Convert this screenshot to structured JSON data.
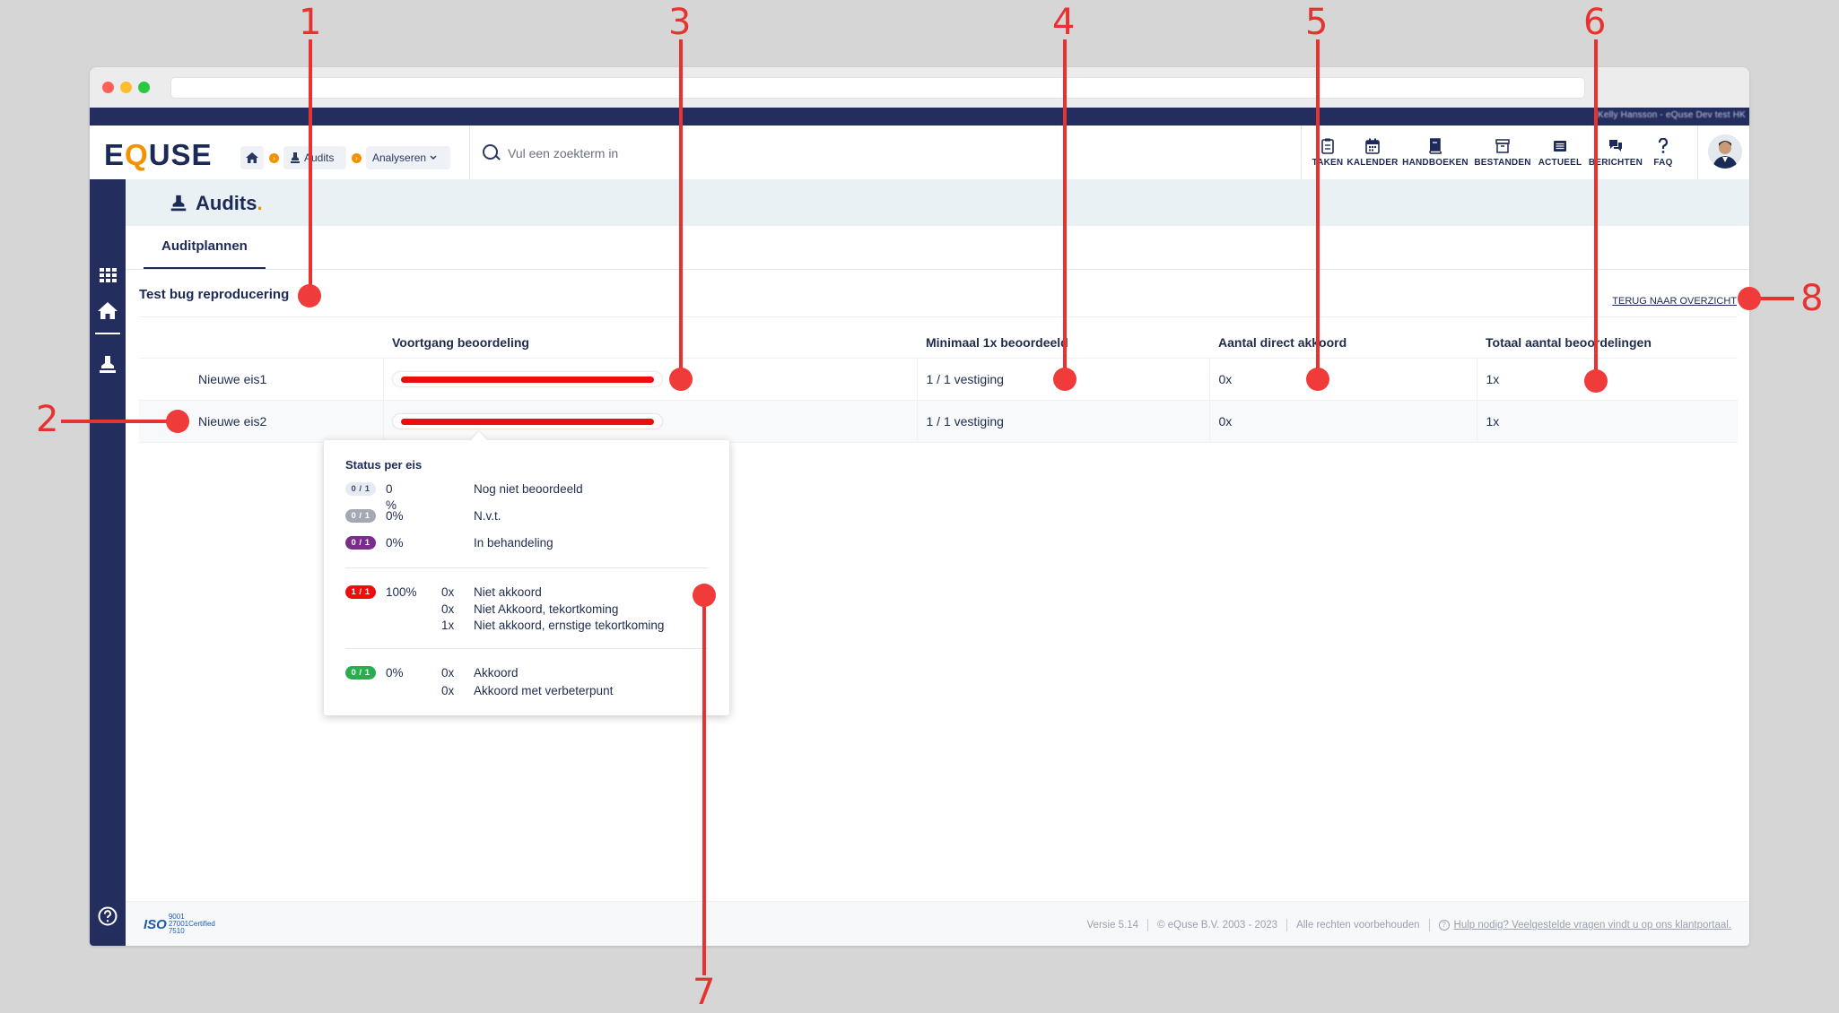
{
  "app": {
    "logo": {
      "pre": "E",
      "q": "Q",
      "post": "USE"
    },
    "user_info": "Kelly Hansson - eQuse Dev test HK",
    "breadcrumb": {
      "item1": "Audits",
      "dropdown": "Analyseren"
    },
    "search": {
      "placeholder": "Vul een zoekterm in"
    },
    "nav": [
      "TAKEN",
      "KALENDER",
      "HANDBOEKEN",
      "BESTANDEN",
      "ACTUEEL",
      "BERICHTEN",
      "FAQ"
    ]
  },
  "page": {
    "title": "Audits",
    "title_dot": ".",
    "tab": "Auditplannen",
    "section_title": "Test bug reproducering",
    "back_link": "TERUG NAAR OVERZICHT"
  },
  "table": {
    "headers": [
      "",
      "Voortgang beoordeling",
      "Minimaal 1x beoordeeld",
      "Aantal direct akkoord",
      "Totaal aantal beoordelingen"
    ],
    "rows": [
      {
        "name": "Nieuwe eis1",
        "progress": 1.0,
        "minimaal": "1 / 1 vestiging",
        "direct": "0x",
        "totaal": "1x"
      },
      {
        "name": "Nieuwe eis2",
        "progress": 1.0,
        "minimaal": "1 / 1 vestiging",
        "direct": "0x",
        "totaal": "1x"
      }
    ]
  },
  "popover": {
    "title": "Status per eis",
    "rows": [
      {
        "badge": "0 / 1",
        "badge_color": "#e5ebf1",
        "badge_text_color": "#3b4a6b",
        "pct": "0 %",
        "count": "",
        "label": "Nog niet beoordeeld"
      },
      {
        "badge": "0 / 1",
        "badge_color": "#a3a8b3",
        "badge_text_color": "#ffffff",
        "pct": "0%",
        "count": "",
        "label": "N.v.t."
      },
      {
        "badge": "0 / 1",
        "badge_color": "#7b2d8e",
        "badge_text_color": "#ffffff",
        "pct": "0%",
        "count": "",
        "label": "In behandeling"
      },
      {
        "badge": "1 / 1",
        "badge_color": "#ee0d0d",
        "badge_text_color": "#ffffff",
        "pct": "100%",
        "count": "0x",
        "label": "Niet akkoord"
      },
      {
        "badge": "",
        "pct": "",
        "count": "0x",
        "label": "Niet Akkoord, tekortkoming"
      },
      {
        "badge": "",
        "pct": "",
        "count": "1x",
        "label": "Niet akkoord, ernstige tekortkoming"
      },
      {
        "badge": "0 / 1",
        "badge_color": "#27ae4f",
        "badge_text_color": "#ffffff",
        "pct": "0%",
        "count": "0x",
        "label": "Akkoord"
      },
      {
        "badge": "",
        "pct": "",
        "count": "0x",
        "label": "Akkoord met verbeterpunt"
      }
    ]
  },
  "footer": {
    "iso_label": "ISO",
    "iso_numbers": [
      "9001",
      "27001",
      "7510"
    ],
    "iso_certified": "Certified",
    "version": "Versie 5.14",
    "copyright": "© eQuse B.V. 2003 - 2023",
    "rights": "Alle rechten voorbehouden",
    "help": "Hulp nodig? Veelgestelde vragen vindt u op ons klantportaal."
  },
  "annotations": [
    "1",
    "2",
    "3",
    "4",
    "5",
    "6",
    "7",
    "8"
  ],
  "colors": {
    "navy": "#232d5e",
    "accent": "#f39200",
    "annotation_red": "#e8322f",
    "progress_red": "#ee0d0d"
  }
}
